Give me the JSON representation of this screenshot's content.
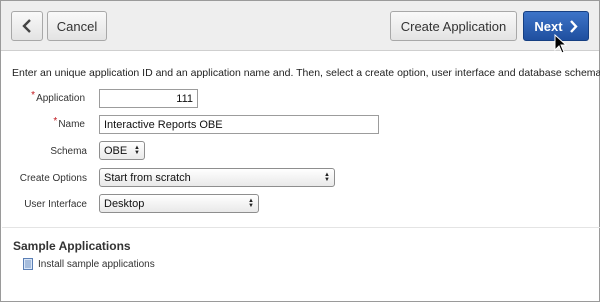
{
  "toolbar": {
    "back_icon": "chevron-left-icon",
    "cancel_label": "Cancel",
    "create_label": "Create Application",
    "next_label": "Next",
    "next_icon": "chevron-right-icon"
  },
  "intro": "Enter an unique application ID and an application name and. Then, select a create option, user interface and database schema.",
  "form": {
    "application": {
      "label": "Application",
      "value": "111",
      "required": true
    },
    "name": {
      "label": "Name",
      "value": "Interactive Reports OBE",
      "required": true
    },
    "schema": {
      "label": "Schema",
      "value": "OBE"
    },
    "create_options": {
      "label": "Create Options",
      "value": "Start from scratch"
    },
    "user_interface": {
      "label": "User Interface",
      "value": "Desktop"
    }
  },
  "sample": {
    "title": "Sample Applications",
    "link_label": "Install sample applications",
    "link_icon": "document-icon"
  },
  "colors": {
    "primary_button": "#2d5fb4",
    "required_star": "#c0161d"
  }
}
